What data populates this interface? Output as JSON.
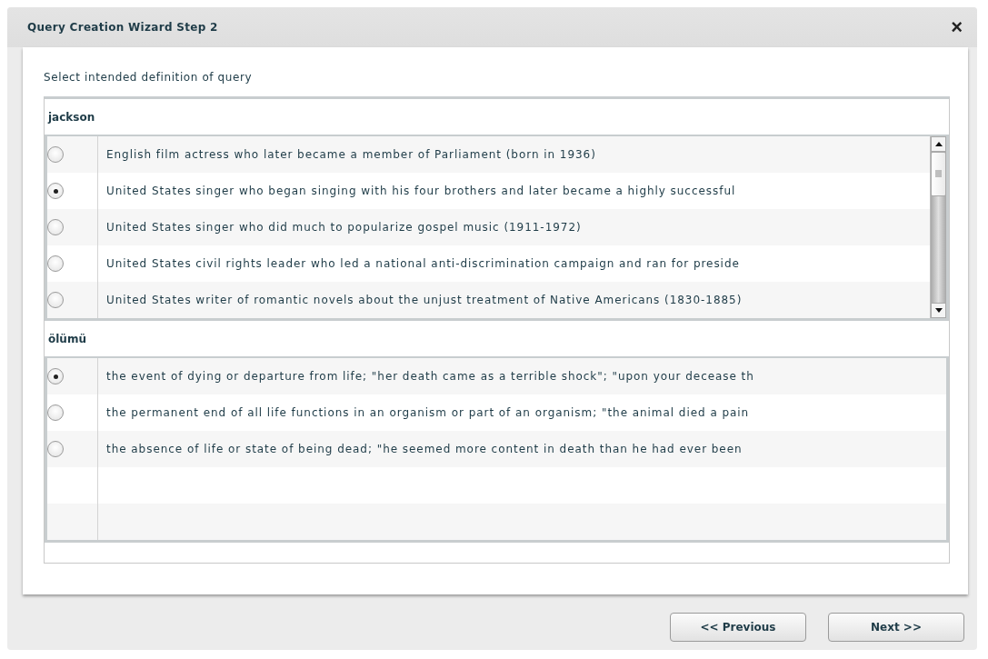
{
  "window": {
    "title": "Query Creation Wizard Step 2",
    "close": "×"
  },
  "instruction": "Select intended definition of query",
  "groups": [
    {
      "term": "jackson",
      "scrollable": true,
      "options": [
        {
          "text": "English film actress who later became a member of Parliament (born in 1936)",
          "selected": false
        },
        {
          "text": "United States singer who began singing with his four brothers and later became a highly successful",
          "selected": true
        },
        {
          "text": "United States singer who did much to popularize gospel music (1911-1972)",
          "selected": false
        },
        {
          "text": "United States civil rights leader who led a national anti-discrimination campaign and ran for preside",
          "selected": false
        },
        {
          "text": "United States writer of romantic novels about the unjust treatment of Native Americans (1830-1885)",
          "selected": false
        }
      ]
    },
    {
      "term": "ölümü",
      "scrollable": false,
      "options": [
        {
          "text": "the event of dying or departure from life; \"her death came as a terrible shock\"; \"upon your decease th",
          "selected": true
        },
        {
          "text": "the permanent end of all life functions in an organism or part of an organism; \"the animal died a pain",
          "selected": false
        },
        {
          "text": "the absence of life or state of being dead; \"he seemed more content in death than he had ever been",
          "selected": false
        }
      ]
    }
  ],
  "buttons": [
    "<< Previous",
    "Next >>"
  ]
}
